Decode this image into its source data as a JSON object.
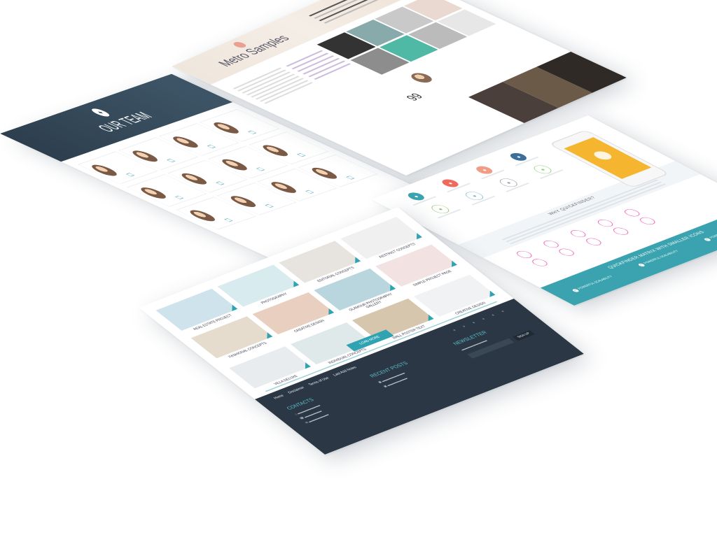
{
  "team_page": {
    "title": "OUR TEAM",
    "badge": "✦"
  },
  "metro_page": {
    "title": "Metro Samples",
    "quote_icon": "99"
  },
  "why_page": {
    "heading": "WHY QUICKFINDER?",
    "footer_title": "QUICKFINDER MATRIX WITH SMALLER ICONS",
    "footer_items": [
      "POWERFUL SCALABILITY",
      "POWERFUL SCALABILITY",
      "POWERFUL SCALABILITY"
    ]
  },
  "portfolio_page": {
    "tiles": [
      {
        "title": "REAL ESTATE PROJECT",
        "color": "#cfe3ec"
      },
      {
        "title": "PHOTOGRAPHY",
        "color": "#d8ecf0"
      },
      {
        "title": "EDITORIAL CONCEPTS",
        "color": "#e7e3de"
      },
      {
        "title": "RESTRICT CONCEPTS",
        "color": "#f0f0f0"
      },
      {
        "title": "FASHIONAL CONCEPTS",
        "color": "#e6dccd"
      },
      {
        "title": "CREATIVE DESIGN",
        "color": "#e9cfc0"
      },
      {
        "title": "GLAMOUR PHOTOGRAPHY GALLERY",
        "color": "#b9d6de"
      },
      {
        "title": "SIMPLE PROJECT PAGE",
        "color": "#f2e2e2"
      },
      {
        "title": "VILLA DELUXE",
        "color": "#e8ecee"
      },
      {
        "title": "INDIVIDUAL CONCEPTS",
        "color": "#dfe9ea"
      },
      {
        "title": "WALL POSTER TEXT",
        "color": "#d6c6ad"
      },
      {
        "title": "CREATIVE DESIGN",
        "color": "#f0f2f4"
      }
    ],
    "load_more": "LOAD MORE",
    "breadcrumbs": [
      "Home",
      "Disclaimer",
      "Terms of Use",
      "Last Add Notes"
    ],
    "contacts_title": "CONTACTS",
    "recent_posts_title": "RECENT POSTS",
    "newsletter_title": "NEWSLETTER",
    "signup": "SIGN UP"
  },
  "colors": {
    "accent": "#2fa3b2",
    "dark_footer": "#2b3744",
    "team_header": "#34495a",
    "why_footer": "#3aa3af"
  }
}
